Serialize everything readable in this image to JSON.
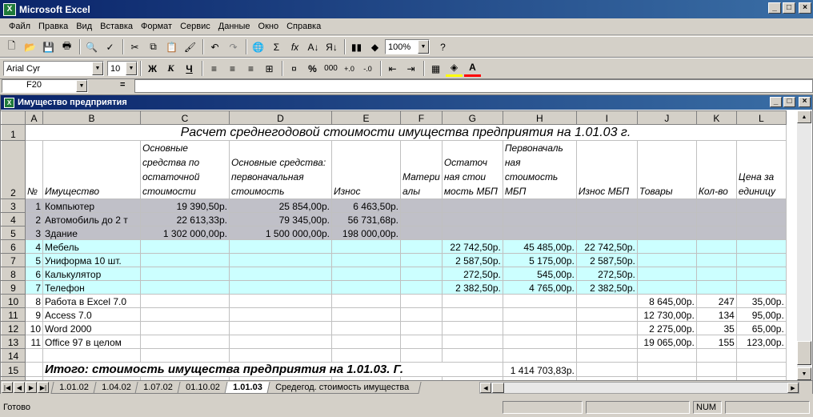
{
  "app": {
    "title": "Microsoft Excel"
  },
  "menu": [
    "Файл",
    "Правка",
    "Вид",
    "Вставка",
    "Формат",
    "Сервис",
    "Данные",
    "Окно",
    "Справка"
  ],
  "toolbar": {
    "zoom": "100%",
    "font": "Arial Cyr",
    "size": "10",
    "bold": "Ж",
    "italic": "К",
    "underline": "Ч",
    "percent": "%",
    "thousands": "000"
  },
  "formula_bar": {
    "cell": "F20",
    "eq": "=",
    "value": ""
  },
  "workbook": {
    "title": "Имущество предприятия"
  },
  "columns": [
    "A",
    "B",
    "C",
    "D",
    "E",
    "F",
    "G",
    "H",
    "I",
    "J",
    "K",
    "L"
  ],
  "sheet": {
    "title_row": "Расчет среднегодовой стоимости имущества предприятия на 1.01.03 г.",
    "headers": {
      "A": "№",
      "B": "Имущество",
      "C": "Основные средства по остаточной стоимости",
      "D": "Основные средства: первоначальная стоимость",
      "E": "Износ",
      "F": "Матери алы",
      "G": "Остаточ ная стои мость МБП",
      "H": "Первоначаль ная стоимость МБП",
      "I": "Износ МБП",
      "J": "Товары",
      "K": "Кол-во",
      "L": "Цена за единицу"
    },
    "rows": [
      {
        "row": "3",
        "group": "gray",
        "A": "1",
        "B": "Компьютер",
        "C": "19 390,50р.",
        "D": "25 854,00р.",
        "E": "6 463,50р.",
        "G": "",
        "H": "",
        "I": "",
        "J": "",
        "K": "",
        "L": ""
      },
      {
        "row": "4",
        "group": "gray",
        "A": "2",
        "B": "Автомобиль до 2 т",
        "C": "22 613,33р.",
        "D": "79 345,00р.",
        "E": "56 731,68р.",
        "G": "",
        "H": "",
        "I": "",
        "J": "",
        "K": "",
        "L": ""
      },
      {
        "row": "5",
        "group": "gray",
        "A": "3",
        "B": "Здание",
        "C": "1 302 000,00р.",
        "D": "1 500 000,00р.",
        "E": "198 000,00р.",
        "G": "",
        "H": "",
        "I": "",
        "J": "",
        "K": "",
        "L": ""
      },
      {
        "row": "6",
        "group": "cyan",
        "A": "4",
        "B": "Мебель",
        "C": "",
        "D": "",
        "E": "",
        "G": "22 742,50р.",
        "H": "45 485,00р.",
        "I": "22 742,50р.",
        "J": "",
        "K": "",
        "L": ""
      },
      {
        "row": "7",
        "group": "cyan",
        "A": "5",
        "B": "Униформа 10 шт.",
        "C": "",
        "D": "",
        "E": "",
        "G": "2 587,50р.",
        "H": "5 175,00р.",
        "I": "2 587,50р.",
        "J": "",
        "K": "",
        "L": ""
      },
      {
        "row": "8",
        "group": "cyan",
        "A": "6",
        "B": "Калькулятор",
        "C": "",
        "D": "",
        "E": "",
        "G": "272,50р.",
        "H": "545,00р.",
        "I": "272,50р.",
        "J": "",
        "K": "",
        "L": ""
      },
      {
        "row": "9",
        "group": "cyan",
        "A": "7",
        "B": "Телефон",
        "C": "",
        "D": "",
        "E": "",
        "G": "2 382,50р.",
        "H": "4 765,00р.",
        "I": "2 382,50р.",
        "J": "",
        "K": "",
        "L": ""
      },
      {
        "row": "10",
        "group": "white",
        "A": "8",
        "B": "Работа в Excel 7.0",
        "C": "",
        "D": "",
        "E": "",
        "G": "",
        "H": "",
        "I": "",
        "J": "8 645,00р.",
        "K": "247",
        "L": "35,00р."
      },
      {
        "row": "11",
        "group": "white",
        "A": "9",
        "B": "Access 7.0",
        "C": "",
        "D": "",
        "E": "",
        "G": "",
        "H": "",
        "I": "",
        "J": "12 730,00р.",
        "K": "134",
        "L": "95,00р."
      },
      {
        "row": "12",
        "group": "white",
        "A": "10",
        "B": "Word 2000",
        "C": "",
        "D": "",
        "E": "",
        "G": "",
        "H": "",
        "I": "",
        "J": "2 275,00р.",
        "K": "35",
        "L": "65,00р."
      },
      {
        "row": "13",
        "group": "white",
        "A": "11",
        "B": "Office 97 в целом",
        "C": "",
        "D": "",
        "E": "",
        "G": "",
        "H": "",
        "I": "",
        "J": "19 065,00р.",
        "K": "155",
        "L": "123,00р."
      }
    ],
    "total_label": "Итого: стоимость имущества предприятия на 1.01.03. Г.",
    "total_value": "1 414 703,83р."
  },
  "tabs": [
    "1.01.02",
    "1.04.02",
    "1.07.02",
    "01.10.02",
    "1.01.03",
    "Средегод. стоимость имущества"
  ],
  "active_tab": "1.01.03",
  "status": {
    "text": "Готово",
    "num": "NUM"
  }
}
